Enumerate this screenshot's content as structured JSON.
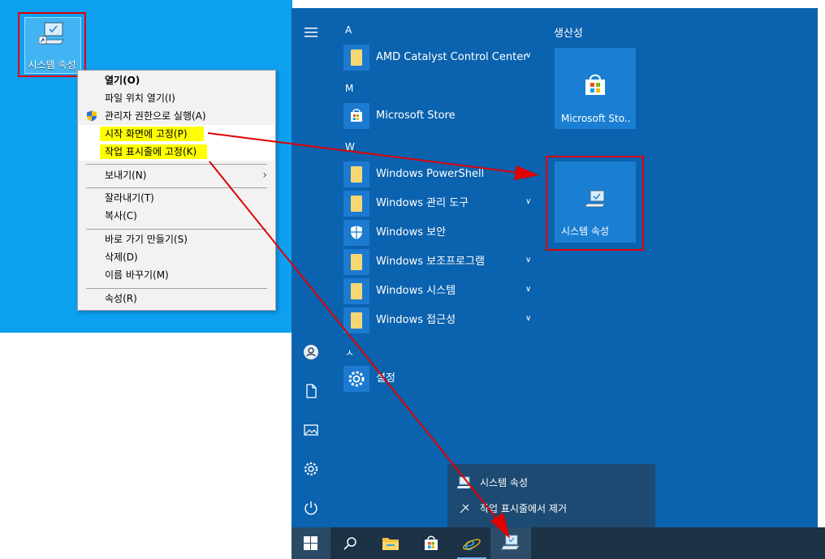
{
  "desktop": {
    "icon_label": "시스템 속성"
  },
  "context_menu": {
    "items": [
      {
        "label": "열기(O)"
      },
      {
        "label": "파일 위치 열기(I)"
      },
      {
        "label": "관리자 권한으로 실행(A)"
      },
      {
        "label": "시작 화면에 고정(P)"
      },
      {
        "label": "작업 표시줄에 고정(K)"
      },
      {
        "label": "보내기(N)"
      },
      {
        "label": "잘라내기(T)"
      },
      {
        "label": "복사(C)"
      },
      {
        "label": "바로 가기 만들기(S)"
      },
      {
        "label": "삭제(D)"
      },
      {
        "label": "이름 바꾸기(M)"
      },
      {
        "label": "속성(R)"
      }
    ]
  },
  "start_menu": {
    "letters": [
      "A",
      "M",
      "W",
      "ㅅ"
    ],
    "apps": [
      {
        "name": "AMD Catalyst Control Center"
      },
      {
        "name": "Microsoft Store"
      },
      {
        "name": "Windows PowerShell"
      },
      {
        "name": "Windows 관리 도구"
      },
      {
        "name": "Windows 보안"
      },
      {
        "name": "Windows 보조프로그램"
      },
      {
        "name": "Windows 시스템"
      },
      {
        "name": "Windows 접근성"
      },
      {
        "name": "설정"
      }
    ],
    "group_title": "생산성",
    "tiles": [
      {
        "label": "Microsoft Sto..."
      },
      {
        "label": "시스템 속성"
      }
    ]
  },
  "jump_list": {
    "items": [
      {
        "label": "시스템 속성"
      },
      {
        "label": "작업 표시줄에서 제거"
      }
    ]
  },
  "colors": {
    "desktop": "#0d9ff0",
    "start_bg": "#0b62ae",
    "tile": "#1a7fd2",
    "highlight": "#ffff00",
    "annotation_red": "#e00000",
    "taskbar": "#1b3247"
  },
  "icons": [
    "hamburger-icon",
    "user-icon",
    "document-icon",
    "pictures-icon",
    "settings-gear-icon",
    "power-icon",
    "windows-logo-icon",
    "search-icon",
    "file-explorer-icon",
    "store-icon",
    "edge-icon",
    "system-properties-icon"
  ]
}
